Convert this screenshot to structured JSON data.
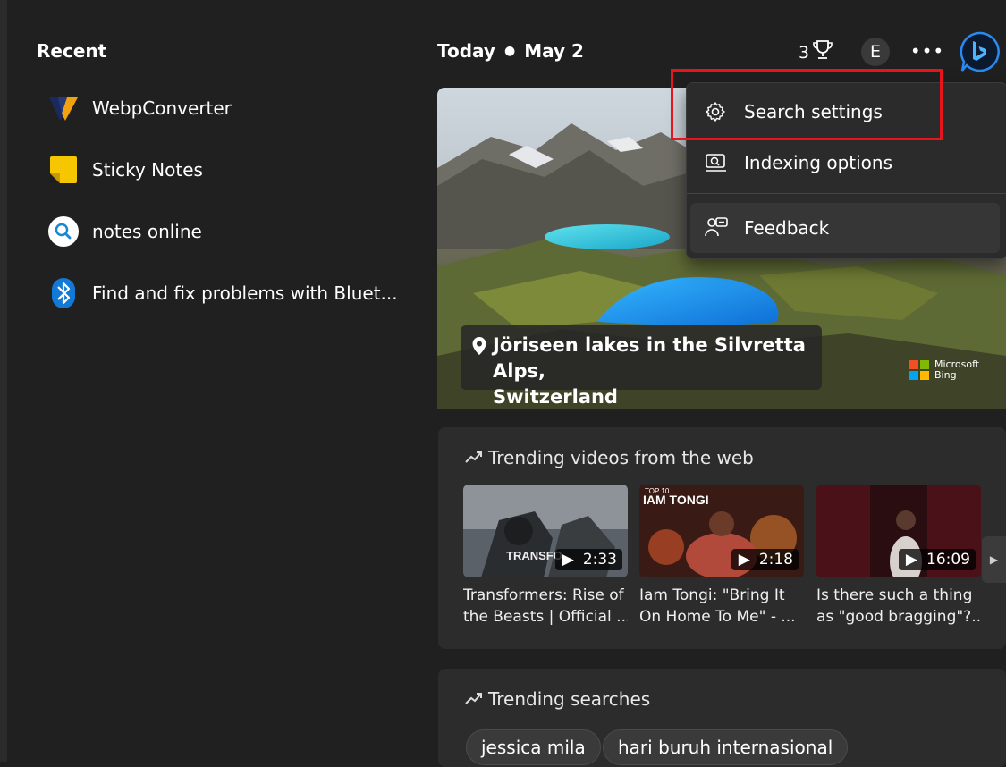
{
  "recent": {
    "title": "Recent",
    "items": [
      {
        "label": "WebpConverter",
        "icon": "webpconverter-app-icon"
      },
      {
        "label": "Sticky Notes",
        "icon": "sticky-notes-icon"
      },
      {
        "label": "notes online",
        "icon": "web-search-icon"
      },
      {
        "label": "Find and fix problems with Bluet...",
        "icon": "bluetooth-icon"
      }
    ]
  },
  "header": {
    "today": "Today",
    "date": "May 2",
    "rewards_count": "3",
    "avatar_initial": "E"
  },
  "hero": {
    "caption_line1": "Jöriseen lakes in the Silvretta Alps,",
    "caption_line2": "Switzerland",
    "brand_line1": "Microsoft",
    "brand_line2": "Bing"
  },
  "menu": {
    "items": [
      {
        "label": "Search settings",
        "icon": "gear-icon"
      },
      {
        "label": "Indexing options",
        "icon": "indexing-icon"
      },
      {
        "label": "Feedback",
        "icon": "feedback-icon"
      }
    ]
  },
  "trending_videos": {
    "title": "Trending videos from the web",
    "videos": [
      {
        "duration": "2:33",
        "title_line1": "Transformers: Rise of",
        "title_line2": "the Beasts | Official ...",
        "thumb_text": "TRANSFO"
      },
      {
        "duration": "2:18",
        "title_line1": "Iam Tongi: \"Bring It",
        "title_line2": "On Home To Me\" - ...",
        "thumb_text": "IAM TONGI",
        "thumb_sub": "TOP 10"
      },
      {
        "duration": "16:09",
        "title_line1": "Is there such a thing",
        "title_line2": "as \"good bragging\"?..."
      }
    ]
  },
  "trending_searches": {
    "title": "Trending searches",
    "pills": [
      "jessica mila",
      "hari buruh internasional"
    ]
  },
  "colors": {
    "background": "#202020",
    "card": "#2c2c2c",
    "highlight": "#e8141c",
    "accent": "#0078d4"
  }
}
